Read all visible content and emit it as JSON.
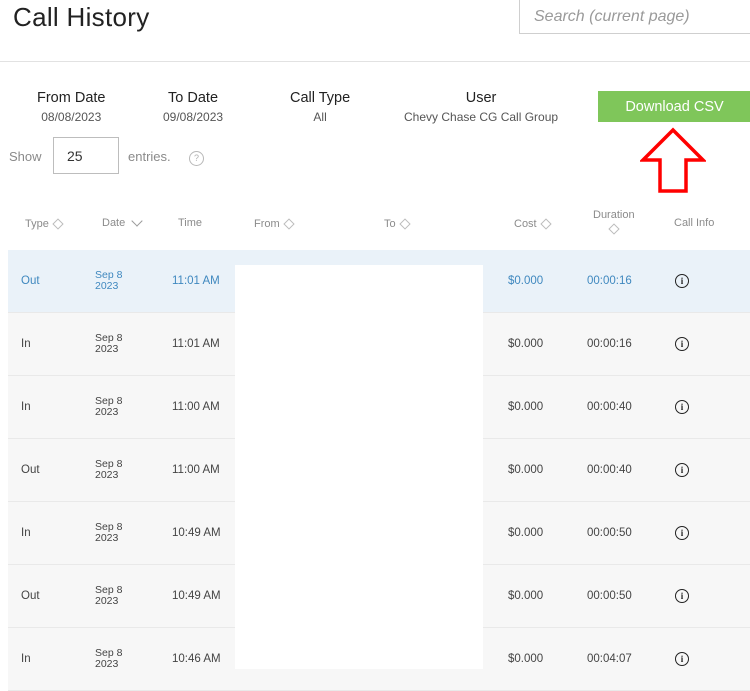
{
  "page": {
    "title": "Call History"
  },
  "search": {
    "placeholder": "Search (current page)"
  },
  "filters": [
    {
      "label": "From Date",
      "value": "08/08/2023"
    },
    {
      "label": "To Date",
      "value": "09/08/2023"
    },
    {
      "label": "Call Type",
      "value": "All"
    },
    {
      "label": "User",
      "value": "Chevy Chase CG Call Group"
    }
  ],
  "download": {
    "label": "Download CSV"
  },
  "entries": {
    "show_label": "Show",
    "value": "25",
    "suffix": "entries.",
    "help": "?"
  },
  "table": {
    "headers": {
      "type": "Type",
      "date": "Date",
      "time": "Time",
      "from": "From",
      "to": "To",
      "cost": "Cost",
      "duration": "Duration",
      "info": "Call Info"
    },
    "rows": [
      {
        "type": "Out",
        "date_md": "Sep 8",
        "date_y": "2023",
        "time": "11:01 AM",
        "cost": "$0.000",
        "duration": "00:00:16"
      },
      {
        "type": "In",
        "date_md": "Sep 8",
        "date_y": "2023",
        "time": "11:01 AM",
        "cost": "$0.000",
        "duration": "00:00:16"
      },
      {
        "type": "In",
        "date_md": "Sep 8",
        "date_y": "2023",
        "time": "11:00 AM",
        "cost": "$0.000",
        "duration": "00:00:40"
      },
      {
        "type": "Out",
        "date_md": "Sep 8",
        "date_y": "2023",
        "time": "11:00 AM",
        "cost": "$0.000",
        "duration": "00:00:40"
      },
      {
        "type": "In",
        "date_md": "Sep 8",
        "date_y": "2023",
        "time": "10:49 AM",
        "cost": "$0.000",
        "duration": "00:00:50"
      },
      {
        "type": "Out",
        "date_md": "Sep 8",
        "date_y": "2023",
        "time": "10:49 AM",
        "cost": "$0.000",
        "duration": "00:00:50"
      },
      {
        "type": "In",
        "date_md": "Sep 8",
        "date_y": "2023",
        "time": "10:46 AM",
        "cost": "$0.000",
        "duration": "00:04:07"
      }
    ],
    "info_glyph": "i",
    "selected_row": 0
  },
  "colors": {
    "accent_green": "#7fc65a",
    "arrow_red": "#ff0000",
    "selected_text": "#3f88bf",
    "selected_bg": "#eaf2f9",
    "row_bg": "#f7f7f7"
  }
}
